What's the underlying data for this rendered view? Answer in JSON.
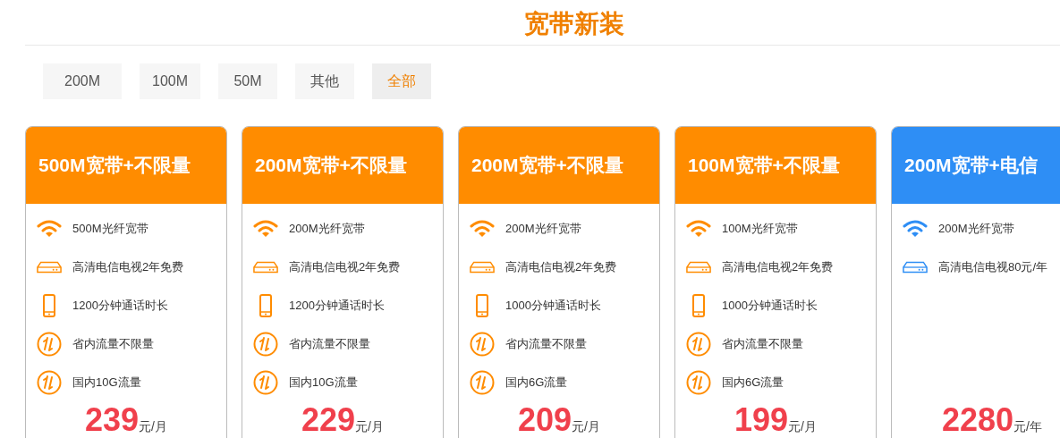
{
  "title": "宽带新装",
  "filters": [
    {
      "label": "200M",
      "selected": false
    },
    {
      "label": "100M",
      "selected": false
    },
    {
      "label": "50M",
      "selected": false
    },
    {
      "label": "其他",
      "selected": false
    },
    {
      "label": "全部",
      "selected": true
    }
  ],
  "plans": [
    {
      "title": "500M宽带+不限量",
      "color": "#ff8c00",
      "features": [
        {
          "kind": "wifi",
          "text": "500M光纤宽带"
        },
        {
          "kind": "tv",
          "text": "高清电信电视2年免费"
        },
        {
          "kind": "phone",
          "text": "1200分钟通话时长"
        },
        {
          "kind": "data",
          "text": "省内流量不限量"
        },
        {
          "kind": "data",
          "text": "国内10G流量"
        }
      ],
      "price": "239",
      "unit": "元/月"
    },
    {
      "title": "200M宽带+不限量",
      "color": "#ff8c00",
      "features": [
        {
          "kind": "wifi",
          "text": "200M光纤宽带"
        },
        {
          "kind": "tv",
          "text": "高清电信电视2年免费"
        },
        {
          "kind": "phone",
          "text": "1200分钟通话时长"
        },
        {
          "kind": "data",
          "text": "省内流量不限量"
        },
        {
          "kind": "data",
          "text": "国内10G流量"
        }
      ],
      "price": "229",
      "unit": "元/月"
    },
    {
      "title": "200M宽带+不限量",
      "color": "#ff8c00",
      "features": [
        {
          "kind": "wifi",
          "text": "200M光纤宽带"
        },
        {
          "kind": "tv",
          "text": "高清电信电视2年免费"
        },
        {
          "kind": "phone",
          "text": "1000分钟通话时长"
        },
        {
          "kind": "data",
          "text": "省内流量不限量"
        },
        {
          "kind": "data",
          "text": "国内6G流量"
        }
      ],
      "price": "209",
      "unit": "元/月"
    },
    {
      "title": "100M宽带+不限量",
      "color": "#ff8c00",
      "features": [
        {
          "kind": "wifi",
          "text": "100M光纤宽带"
        },
        {
          "kind": "tv",
          "text": "高清电信电视2年免费"
        },
        {
          "kind": "phone",
          "text": "1000分钟通话时长"
        },
        {
          "kind": "data",
          "text": "省内流量不限量"
        },
        {
          "kind": "data",
          "text": "国内6G流量"
        }
      ],
      "price": "199",
      "unit": "元/月"
    },
    {
      "title": "200M宽带+电信",
      "color": "#2e8ef5",
      "features": [
        {
          "kind": "wifi",
          "text": "200M光纤宽带"
        },
        {
          "kind": "tv",
          "text": "高清电信电视80元/年"
        }
      ],
      "price": "2280",
      "unit": "元/年"
    }
  ]
}
